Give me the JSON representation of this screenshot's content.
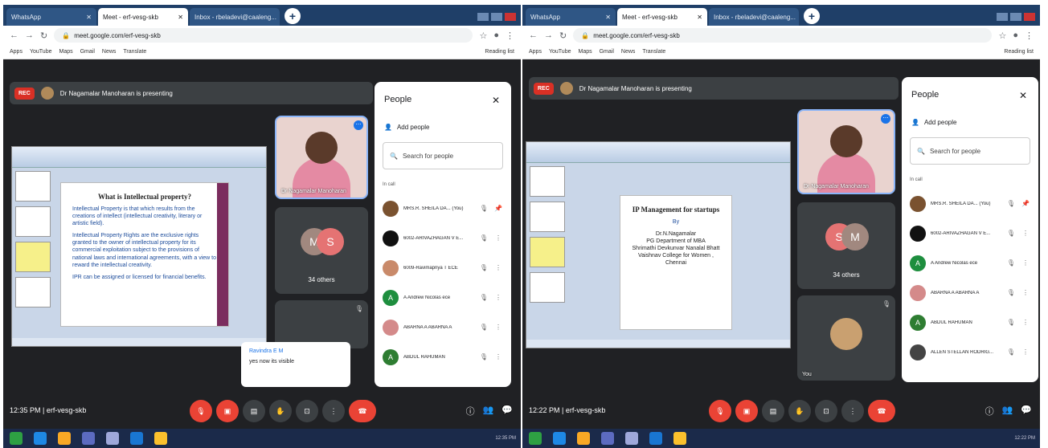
{
  "panels": [
    {
      "tabs": [
        "WhatsApp",
        "Meet - erf-vesg-skb",
        "Inbox - rbeladevi@caaleng..."
      ],
      "url": "meet.google.com/erf-vesg-skb",
      "bookmarks": [
        "Apps",
        "YouTube",
        "Maps",
        "Gmail",
        "News",
        "Translate"
      ],
      "reading_list": "Reading list",
      "rec": "REC",
      "presenting": "Dr Nagamalar Manoharan is presenting",
      "slide_title": "What is Intellectual property?",
      "slide_lines": [
        "Intellectual Property is that which results from the creations of intellect (intellectual creativity, literary or artistic field).",
        "Intellectual Property Rights are the exclusive rights granted to the owner of intellectual property for its commercial exploitation subject to the provisions of national laws and international agreements, with a view to reward the intellectual creativity.",
        "IPR can be assigned or licensed for financial benefits."
      ],
      "presenter_label": "Dr Nagamalar Manoharan",
      "others_initials": [
        "M",
        "S"
      ],
      "others_count": "34 others",
      "chat_name": "Ravindra E M",
      "chat_msg": "yes now its visible",
      "people_title": "People",
      "add_people": "Add people",
      "search_placeholder": "Search for people",
      "in_call": "In call",
      "participants": [
        "MRS.R. SHEILA DA... (You)",
        "6002-ARIVAZHAGAN V E...",
        "6009-Ravimapriya T ECE",
        "A Andrew Nicolas ece",
        "ABARNA A ABARNA A",
        "ABDUL RAHUMAN"
      ],
      "time": "12:35 PM",
      "meeting_code": "erf-vesg-skb",
      "tray_time": "12:35 PM"
    },
    {
      "tabs": [
        "WhatsApp",
        "Meet - erf-vesg-skb",
        "Inbox - rbeladevi@caaleng..."
      ],
      "url": "meet.google.com/erf-vesg-skb",
      "bookmarks": [
        "Apps",
        "YouTube",
        "Maps",
        "Gmail",
        "News",
        "Translate"
      ],
      "reading_list": "Reading list",
      "rec": "REC",
      "presenting": "Dr Nagamalar Manoharan is presenting",
      "slide_title": "IP Management for startups",
      "slide_lines": [
        "By",
        "Dr.N.Nagamalar",
        "PG Department of MBA",
        "Shrimathi Devkunvar Nanalal Bhatt Vaishnav College for Women , Chennai"
      ],
      "presenter_label": "Dr Nagamalar Manoharan",
      "others_initials": [
        "S",
        "M"
      ],
      "others_count": "34 others",
      "you_label": "You",
      "people_title": "People",
      "add_people": "Add people",
      "search_placeholder": "Search for people",
      "in_call": "In call",
      "participants": [
        "MRS.R. SHEILA DA... (You)",
        "6002-ARIVAZHAGAN V E...",
        "A Andrew Nicolas ece",
        "ABARNA A ABARNA A",
        "ABDUL RAHUMAN",
        "ALLEN STELLAN RODRIG..."
      ],
      "time": "12:22 PM",
      "meeting_code": "erf-vesg-skb",
      "tray_time": "12:22 PM"
    }
  ],
  "colors": {
    "meet_bg": "#202124",
    "tile_bg": "#3c4043",
    "end_call": "#ea4335",
    "accent": "#1a73e8"
  }
}
